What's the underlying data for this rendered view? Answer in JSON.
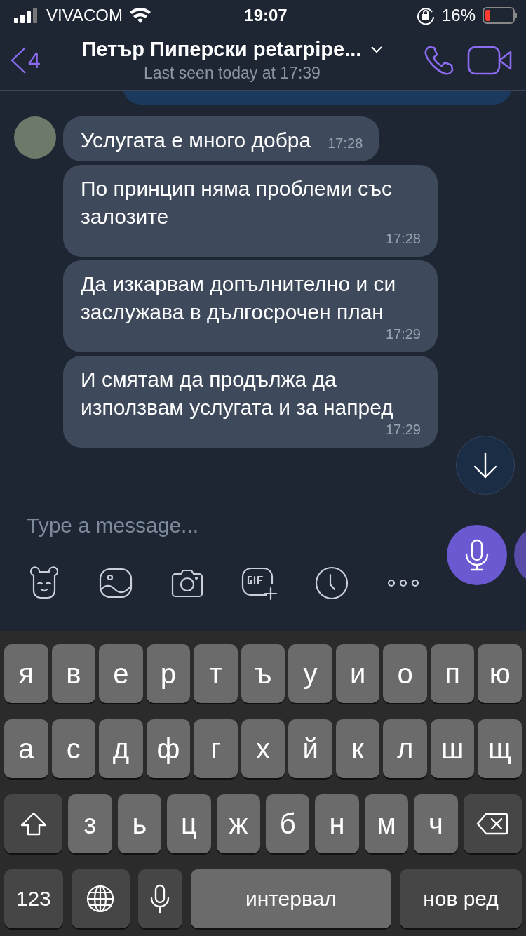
{
  "status_bar": {
    "carrier": "VIVACOM",
    "time": "19:07",
    "battery": "16%"
  },
  "header": {
    "back_count": "4",
    "title": "Петър Пиперски petarpipe...",
    "subtitle": "Last seen today at 17:39"
  },
  "messages": [
    {
      "text": "Услугата е много добра",
      "time": "17:28"
    },
    {
      "text": "По принцип няма проблеми със залозите",
      "time": "17:28"
    },
    {
      "text": "Да изкарвам допълнително и си заслужава в дългосрочен план",
      "time": "17:29"
    },
    {
      "text": "И смятам да продължа да използвам услугата и за напред",
      "time": "17:29"
    }
  ],
  "composer": {
    "placeholder": "Type a message..."
  },
  "keyboard": {
    "letter_rows": [
      [
        {
          "kind": "letter",
          "label": "я"
        },
        {
          "kind": "letter",
          "label": "в"
        },
        {
          "kind": "letter",
          "label": "е"
        },
        {
          "kind": "letter",
          "label": "р"
        },
        {
          "kind": "letter",
          "label": "т"
        },
        {
          "kind": "letter",
          "label": "ъ"
        },
        {
          "kind": "letter",
          "label": "у"
        },
        {
          "kind": "letter",
          "label": "и"
        },
        {
          "kind": "letter",
          "label": "о"
        },
        {
          "kind": "letter",
          "label": "п"
        },
        {
          "kind": "letter",
          "label": "ю"
        }
      ],
      [
        {
          "kind": "letter",
          "label": "а"
        },
        {
          "kind": "letter",
          "label": "с"
        },
        {
          "kind": "letter",
          "label": "д"
        },
        {
          "kind": "letter",
          "label": "ф"
        },
        {
          "kind": "letter",
          "label": "г"
        },
        {
          "kind": "letter",
          "label": "х"
        },
        {
          "kind": "letter",
          "label": "й"
        },
        {
          "kind": "letter",
          "label": "к"
        },
        {
          "kind": "letter",
          "label": "л"
        },
        {
          "kind": "letter",
          "label": "ш"
        },
        {
          "kind": "letter",
          "label": "щ"
        }
      ],
      [
        {
          "kind": "shift"
        },
        {
          "kind": "letter",
          "label": "з"
        },
        {
          "kind": "letter",
          "label": "ь"
        },
        {
          "kind": "letter",
          "label": "ц"
        },
        {
          "kind": "letter",
          "label": "ж"
        },
        {
          "kind": "letter",
          "label": "б"
        },
        {
          "kind": "letter",
          "label": "н"
        },
        {
          "kind": "letter",
          "label": "м"
        },
        {
          "kind": "letter",
          "label": "ч"
        },
        {
          "kind": "backspace"
        }
      ]
    ],
    "function_keys": [
      {
        "kind": "numbers",
        "label": "123"
      },
      {
        "kind": "globe"
      },
      {
        "kind": "mic"
      },
      {
        "kind": "space",
        "label": "интервал"
      },
      {
        "kind": "return",
        "label": "нов ред"
      }
    ]
  }
}
